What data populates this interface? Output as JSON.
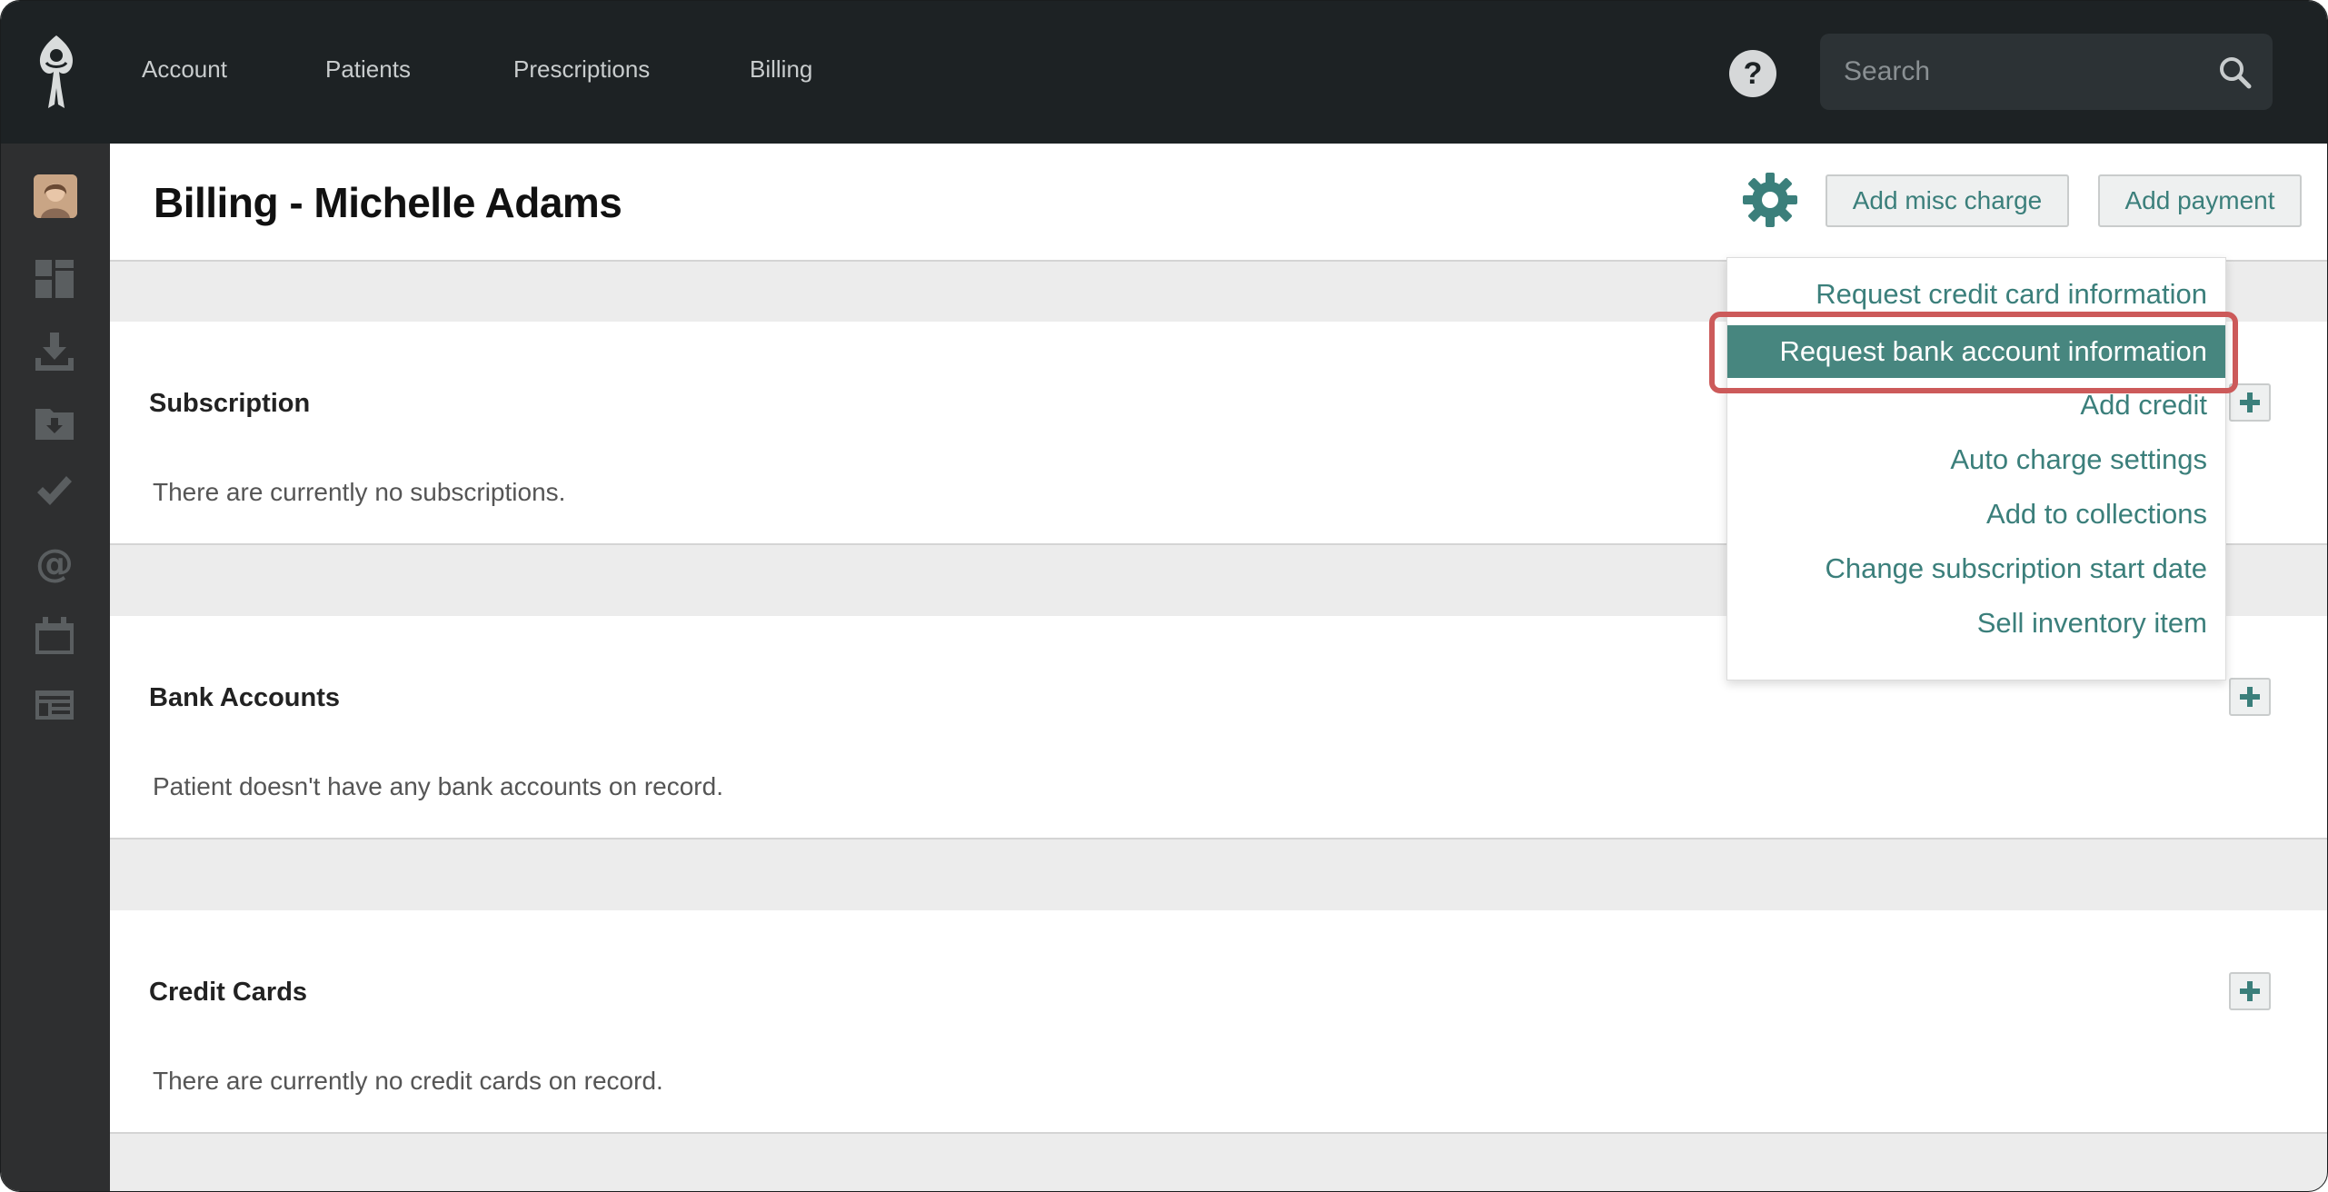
{
  "nav": {
    "links": [
      "Account",
      "Patients",
      "Prescriptions",
      "Billing"
    ],
    "help_label": "?",
    "search_placeholder": "Search"
  },
  "sidebar": {
    "icons": [
      "avatar",
      "dashboard-icon",
      "download-icon",
      "folder-download-icon",
      "check-icon",
      "at-icon",
      "calendar-icon",
      "newspaper-icon"
    ]
  },
  "header": {
    "title": "Billing - Michelle Adams",
    "add_misc_charge_label": "Add misc charge",
    "add_payment_label": "Add payment"
  },
  "sections": {
    "subscription": {
      "title": "Subscription",
      "empty_text": "There are currently no subscriptions."
    },
    "bank_accounts": {
      "title": "Bank Accounts",
      "empty_text": "Patient doesn't have any bank accounts on record."
    },
    "credit_cards": {
      "title": "Credit Cards",
      "empty_text": "There are currently no credit cards on record."
    }
  },
  "dropdown": {
    "items": [
      "Request credit card information",
      "Request bank account information",
      "Add credit",
      "Auto charge settings",
      "Add to collections",
      "Change subscription start date",
      "Sell inventory item"
    ],
    "active_item": "Request bank account information"
  },
  "colors": {
    "accent": "#3b7f7b",
    "active_bg": "#47867f",
    "topbar": "#1d2224",
    "sidebar": "#2e2f30",
    "highlight": "#cc5a5a"
  }
}
